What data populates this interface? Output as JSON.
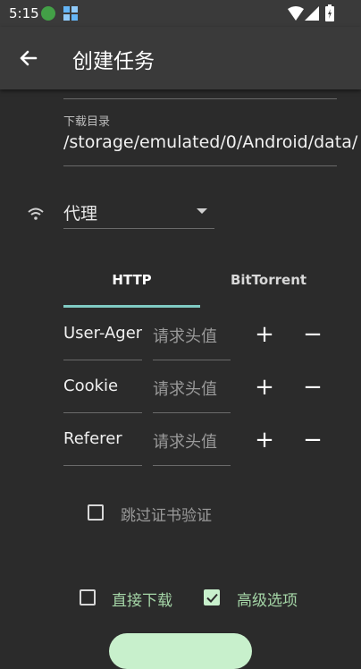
{
  "status_bar": {
    "time": "5:15"
  },
  "app_bar": {
    "title": "创建任务",
    "back_icon": "arrow-left-icon"
  },
  "download_dir": {
    "label": "下载目录",
    "value": "/storage/emulated/0/Android/data/"
  },
  "proxy": {
    "label": "代理",
    "icon": "wifi-icon"
  },
  "tabs": [
    {
      "label": "HTTP",
      "selected": true
    },
    {
      "label": "BitTorrent",
      "selected": false
    }
  ],
  "headers": [
    {
      "name": "User-Agen",
      "value_placeholder": "请求头值"
    },
    {
      "name": "Cookie",
      "value_placeholder": "请求头值"
    },
    {
      "name": "Referer",
      "value_placeholder": "请求头值"
    }
  ],
  "options": {
    "skip_cert": {
      "label": "跳过证书验证",
      "checked": false
    },
    "direct_download": {
      "label": "直接下载",
      "checked": false
    },
    "advanced": {
      "label": "高级选项",
      "checked": true
    }
  },
  "colors": {
    "accent": "#80cbc4",
    "checkbox_green": "#c8f0cc",
    "label_green": "#a5d6a7",
    "background": "#2b2b2b",
    "toolbar": "#3a3a3a"
  }
}
